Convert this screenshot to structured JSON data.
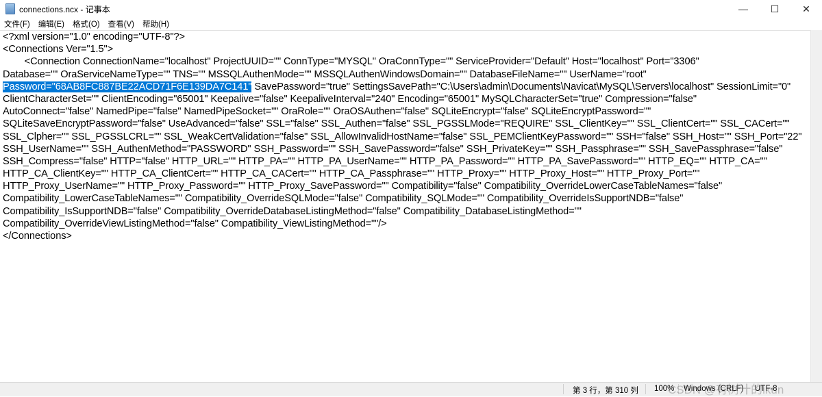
{
  "window": {
    "title": "connections.ncx - 记事本",
    "minimize": "—",
    "maximize": "☐",
    "close": "✕"
  },
  "menu": [
    "文件(F)",
    "编辑(E)",
    "格式(O)",
    "查看(V)",
    "帮助(H)"
  ],
  "editor": {
    "lines_before": [
      "<?xml version=\"1.0\" encoding=\"UTF-8\"?>",
      "<Connections Ver=\"1.5\">",
      "\t\t<Connection ConnectionName=\"localhost\" ProjectUUID=\"\" ConnType=\"MYSQL\" OraConnType=\"\" ServiceProvider=\"Default\" Host=\"localhost\" Port=\"3306\"",
      "Database=\"\" OraServiceNameType=\"\" TNS=\"\" MSSQLAuthenMode=\"\" MSSQLAuthenWindowsDomain=\"\" DatabaseFileName=\"\" UserName=\"root\""
    ],
    "selected_text": "Password=\"68AB8FC887BE22ACD71F6E139DA7C141\"",
    "selected_line_rest": " SavePassword=\"true\" SettingsSavePath=\"C:\\Users\\admin\\Documents\\Navicat\\MySQL\\Servers\\localhost\" SessionLimit=\"0\"",
    "lines_after": [
      "ClientCharacterSet=\"\" ClientEncoding=\"65001\" Keepalive=\"false\" KeepaliveInterval=\"240\" Encoding=\"65001\" MySQLCharacterSet=\"true\" Compression=\"false\"",
      "AutoConnect=\"false\" NamedPipe=\"false\" NamedPipeSocket=\"\" OraRole=\"\" OraOSAuthen=\"false\" SQLiteEncrypt=\"false\" SQLiteEncryptPassword=\"\"",
      "SQLiteSaveEncryptPassword=\"false\" UseAdvanced=\"false\" SSL=\"false\" SSL_Authen=\"false\" SSL_PGSSLMode=\"REQUIRE\" SSL_ClientKey=\"\" SSL_ClientCert=\"\" SSL_CACert=\"\"",
      "SSL_Clpher=\"\" SSL_PGSSLCRL=\"\" SSL_WeakCertValidation=\"false\" SSL_AllowInvalidHostName=\"false\" SSL_PEMClientKeyPassword=\"\" SSH=\"false\" SSH_Host=\"\" SSH_Port=\"22\"",
      "SSH_UserName=\"\" SSH_AuthenMethod=\"PASSWORD\" SSH_Password=\"\" SSH_SavePassword=\"false\" SSH_PrivateKey=\"\" SSH_Passphrase=\"\" SSH_SavePassphrase=\"false\"",
      "SSH_Compress=\"false\" HTTP=\"false\" HTTP_URL=\"\" HTTP_PA=\"\" HTTP_PA_UserName=\"\" HTTP_PA_Password=\"\" HTTP_PA_SavePassword=\"\" HTTP_EQ=\"\" HTTP_CA=\"\"",
      "HTTP_CA_ClientKey=\"\" HTTP_CA_ClientCert=\"\" HTTP_CA_CACert=\"\" HTTP_CA_Passphrase=\"\" HTTP_Proxy=\"\" HTTP_Proxy_Host=\"\" HTTP_Proxy_Port=\"\"",
      "HTTP_Proxy_UserName=\"\" HTTP_Proxy_Password=\"\" HTTP_Proxy_SavePassword=\"\" Compatibility=\"false\" Compatibility_OverrideLowerCaseTableNames=\"false\"",
      "Compatibility_LowerCaseTableNames=\"\" Compatibility_OverrideSQLMode=\"false\" Compatibility_SQLMode=\"\" Compatibility_OverrideIsSupportNDB=\"false\"",
      "Compatibility_IsSupportNDB=\"false\" Compatibility_OverrideDatabaseListingMethod=\"false\" Compatibility_DatabaseListingMethod=\"\"",
      "Compatibility_OverrideViewListingMethod=\"false\" Compatibility_ViewListingMethod=\"\"/>",
      "</Connections>"
    ]
  },
  "status": {
    "position": "第 3 行，第 310 列",
    "zoom": "100%",
    "line_ending": "Windows (CRLF)",
    "encoding": "UTF-8"
  },
  "watermark": "CSDN @有树汁的ikun"
}
